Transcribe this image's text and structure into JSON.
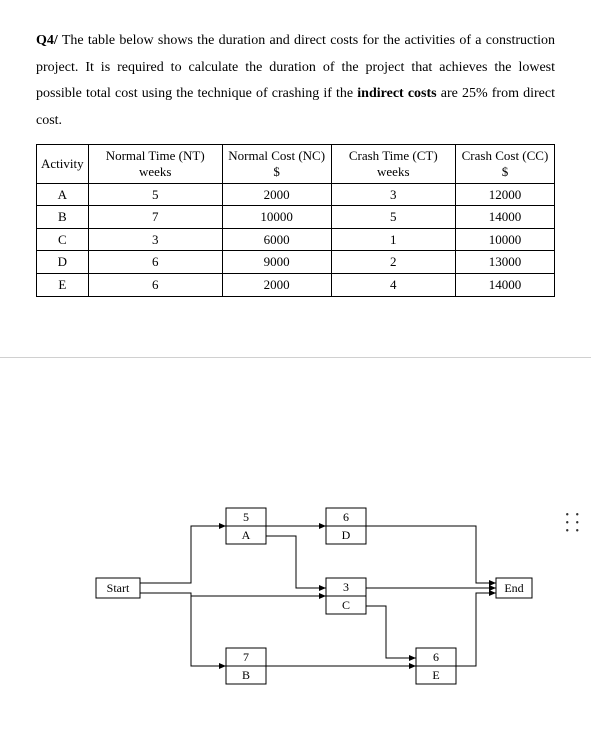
{
  "question": {
    "label": "Q4/",
    "text_part1": " The table below shows the duration and direct costs for the activities of a construction project.  It is required to calculate the duration of the project that achieves the lowest possible total cost using the technique of  crashing if the ",
    "bold_phrase": "indirect costs",
    "text_part2": " are 25% from direct cost."
  },
  "table": {
    "headers": {
      "activity": "Activity",
      "nt": "Normal Time (NT) weeks",
      "nc": "Normal Cost (NC) $",
      "ct": "Crash Time (CT) weeks",
      "cc": "Crash Cost (CC) $"
    },
    "rows": [
      {
        "activity": "A",
        "nt": "5",
        "nc": "2000",
        "ct": "3",
        "cc": "12000"
      },
      {
        "activity": "B",
        "nt": "7",
        "nc": "10000",
        "ct": "5",
        "cc": "14000"
      },
      {
        "activity": "C",
        "nt": "3",
        "nc": "6000",
        "ct": "1",
        "cc": "10000"
      },
      {
        "activity": "D",
        "nt": "6",
        "nc": "9000",
        "ct": "2",
        "cc": "13000"
      },
      {
        "activity": "E",
        "nt": "6",
        "nc": "2000",
        "ct": "4",
        "cc": "14000"
      }
    ]
  },
  "diagram": {
    "nodes": {
      "start": {
        "label": "Start"
      },
      "a": {
        "duration": "5",
        "name": "A"
      },
      "b": {
        "duration": "7",
        "name": "B"
      },
      "c": {
        "duration": "3",
        "name": "C"
      },
      "d": {
        "duration": "6",
        "name": "D"
      },
      "e": {
        "duration": "6",
        "name": "E"
      },
      "end": {
        "label": "End"
      }
    }
  }
}
